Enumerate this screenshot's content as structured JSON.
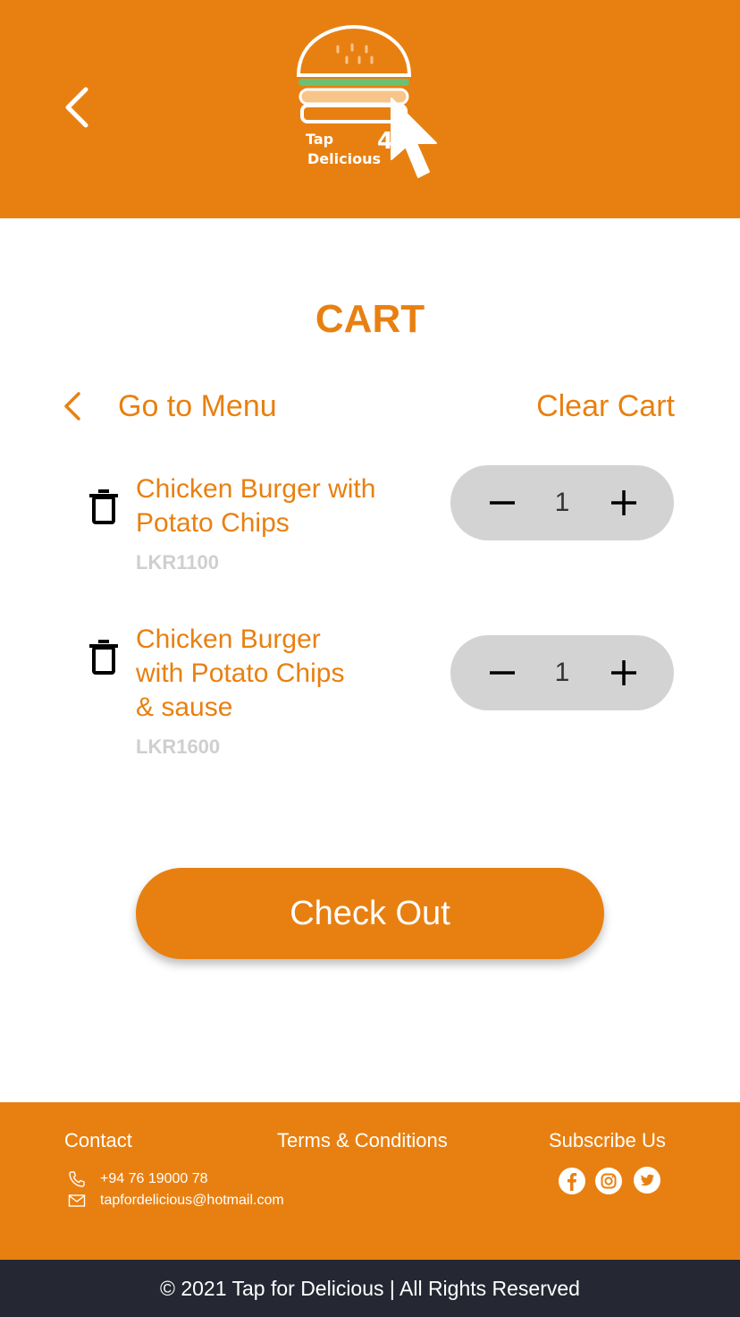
{
  "header": {
    "logo_line1": "Tap",
    "logo_line2": "Delicious",
    "logo_digit": "4",
    "icons": {
      "back": "chevron-left-icon",
      "logo": "burger-cursor-logo"
    }
  },
  "cart": {
    "title": "CART",
    "go_to_menu": "Go to Menu",
    "clear_cart": "Clear Cart",
    "items": [
      {
        "name_lines": [
          "Chicken Burger with",
          "Potato Chips"
        ],
        "price": "LKR1100",
        "qty": "1"
      },
      {
        "name_lines": [
          "Chicken Burger",
          "with Potato Chips",
          "& sause"
        ],
        "price": "LKR1600",
        "qty": "1"
      }
    ],
    "checkout": "Check Out"
  },
  "footer": {
    "contact_heading": "Contact",
    "terms": "Terms & Conditions",
    "subscribe": "Subscribe Us",
    "phone": "+94 76 19000 78",
    "email": "tapfordelicious@hotmail.com",
    "social": [
      "facebook-icon",
      "instagram-icon",
      "twitter-icon"
    ],
    "copyright": "© 2021 Tap for Delicious | All Rights Reserved"
  },
  "colors": {
    "accent": "#E88011",
    "stepper": "#D3D3D3",
    "price": "#CFCFCF",
    "bottom_bar": "#252833"
  }
}
